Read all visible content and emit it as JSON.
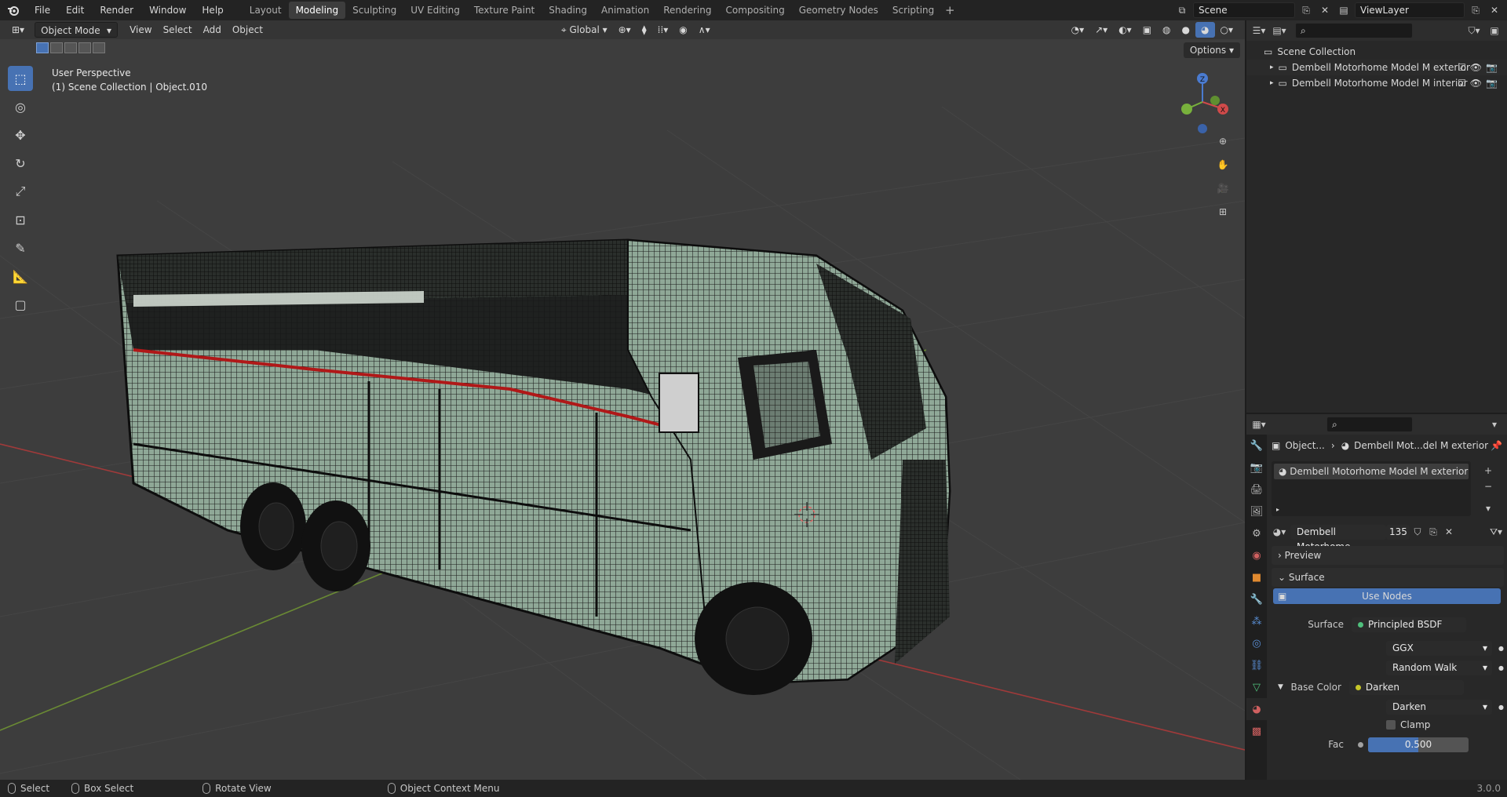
{
  "app": {
    "name": "Blender",
    "version": "3.0.0"
  },
  "menubar": {
    "items": [
      "File",
      "Edit",
      "Render",
      "Window",
      "Help"
    ],
    "workspaces": [
      "Layout",
      "Modeling",
      "Sculpting",
      "UV Editing",
      "Texture Paint",
      "Shading",
      "Animation",
      "Rendering",
      "Compositing",
      "Geometry Nodes",
      "Scripting"
    ],
    "active_workspace": "Modeling",
    "scene": "Scene",
    "view_layer": "ViewLayer"
  },
  "viewport": {
    "mode": "Object Mode",
    "menus": [
      "View",
      "Select",
      "Add",
      "Object"
    ],
    "orientation": "Global",
    "options_label": "Options",
    "perspective_label": "User Perspective",
    "collection_label": "(1) Scene Collection | Object.010",
    "gizmo_axes": [
      "X",
      "Y",
      "Z"
    ]
  },
  "outliner": {
    "root": "Scene Collection",
    "items": [
      {
        "label": "Dembell Motorhome Model M exterior"
      },
      {
        "label": "Dembell Motorhome Model M  interior"
      }
    ]
  },
  "properties": {
    "breadcrumb_object": "Object...",
    "breadcrumb_material": "Dembell Mot...del M exterior",
    "material_slot": "Dembell Motorhome Model M exterior",
    "material_name": "Dembell Motorhome ...",
    "user_count": "135",
    "panels": {
      "preview": "Preview",
      "surface": "Surface"
    },
    "use_nodes_label": "Use Nodes",
    "surface_label": "Surface",
    "surface_value": "Principled BSDF",
    "distribution": "GGX",
    "subsurface_method": "Random Walk",
    "base_color_label": "Base Color",
    "base_color_value": "Darken",
    "blend_mode": "Darken",
    "clamp_label": "Clamp",
    "fac_label": "Fac",
    "fac_value": "0.500",
    "fac_level": 0.5
  },
  "statusbar": {
    "items": [
      "Select",
      "Box Select",
      "Rotate View",
      "Object Context Menu"
    ],
    "version": "3.0.0"
  },
  "colors": {
    "accent": "#4772b3",
    "grid_x": "#a03a3a",
    "grid_y": "#6a8a34",
    "mesh_fill": "#8fa897",
    "mesh_dark": "#121212",
    "stripe_red": "#b01818"
  }
}
